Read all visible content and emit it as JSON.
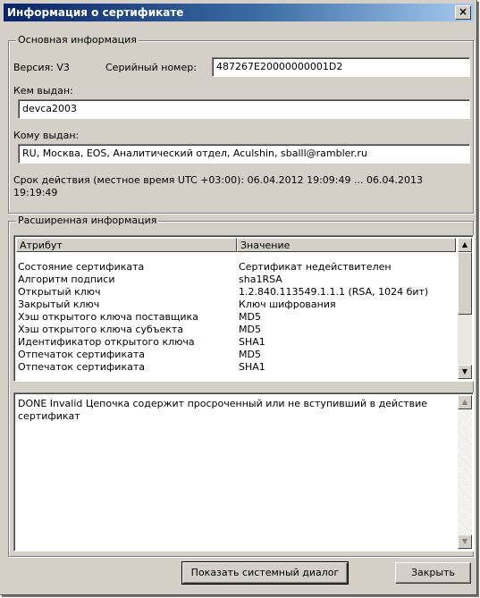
{
  "window": {
    "title": "Информация о сертификате",
    "close_label": "×"
  },
  "basic": {
    "legend": "Основная информация",
    "version": "Версия: V3",
    "serial_label": "Серийный номер:",
    "serial_value": "487267E20000000001D2",
    "issuer_label": "Кем выдан:",
    "issuer_value": "devca2003",
    "subject_label": "Кому выдан:",
    "subject_value": "RU, Москва, EOS, Аналитический отдел, Aculshin, sballl@rambler.ru",
    "validity_line1": "Срок действия (местное время UTC +03:00):  06.04.2012 19:09:49 ... 06.04.2013",
    "validity_line2": "19:19:49"
  },
  "extended": {
    "legend": "Расширенная информация",
    "columns": [
      "Атрибут",
      "Значение"
    ],
    "rows": [
      [
        "Состояние сертификата",
        "Сертификат недействителен"
      ],
      [
        "Алгоритм подписи",
        "sha1RSA"
      ],
      [
        "Открытый ключ",
        "1.2.840.113549.1.1.1 (RSA, 1024 бит)"
      ],
      [
        "Закрытый ключ",
        "Ключ шифрования"
      ],
      [
        "Хэш открытого ключа поставщика",
        "MD5"
      ],
      [
        "Хэш открытого ключа субъекта",
        "MD5"
      ],
      [
        "Идентификатор открытого ключа",
        "SHA1"
      ],
      [
        "Отпечаток сертификата",
        "MD5"
      ],
      [
        "Отпечаток сертификата",
        "SHA1"
      ]
    ],
    "details_line1": "DONE Invalid Цепочка содержит просроченный или не вступивший в действие",
    "details_line2": "сертификат"
  },
  "buttons": {
    "system_dialog": "Показать системный диалог",
    "close": "Закрыть"
  },
  "icons": {
    "scroll_up": "▲",
    "scroll_down": "▼"
  }
}
